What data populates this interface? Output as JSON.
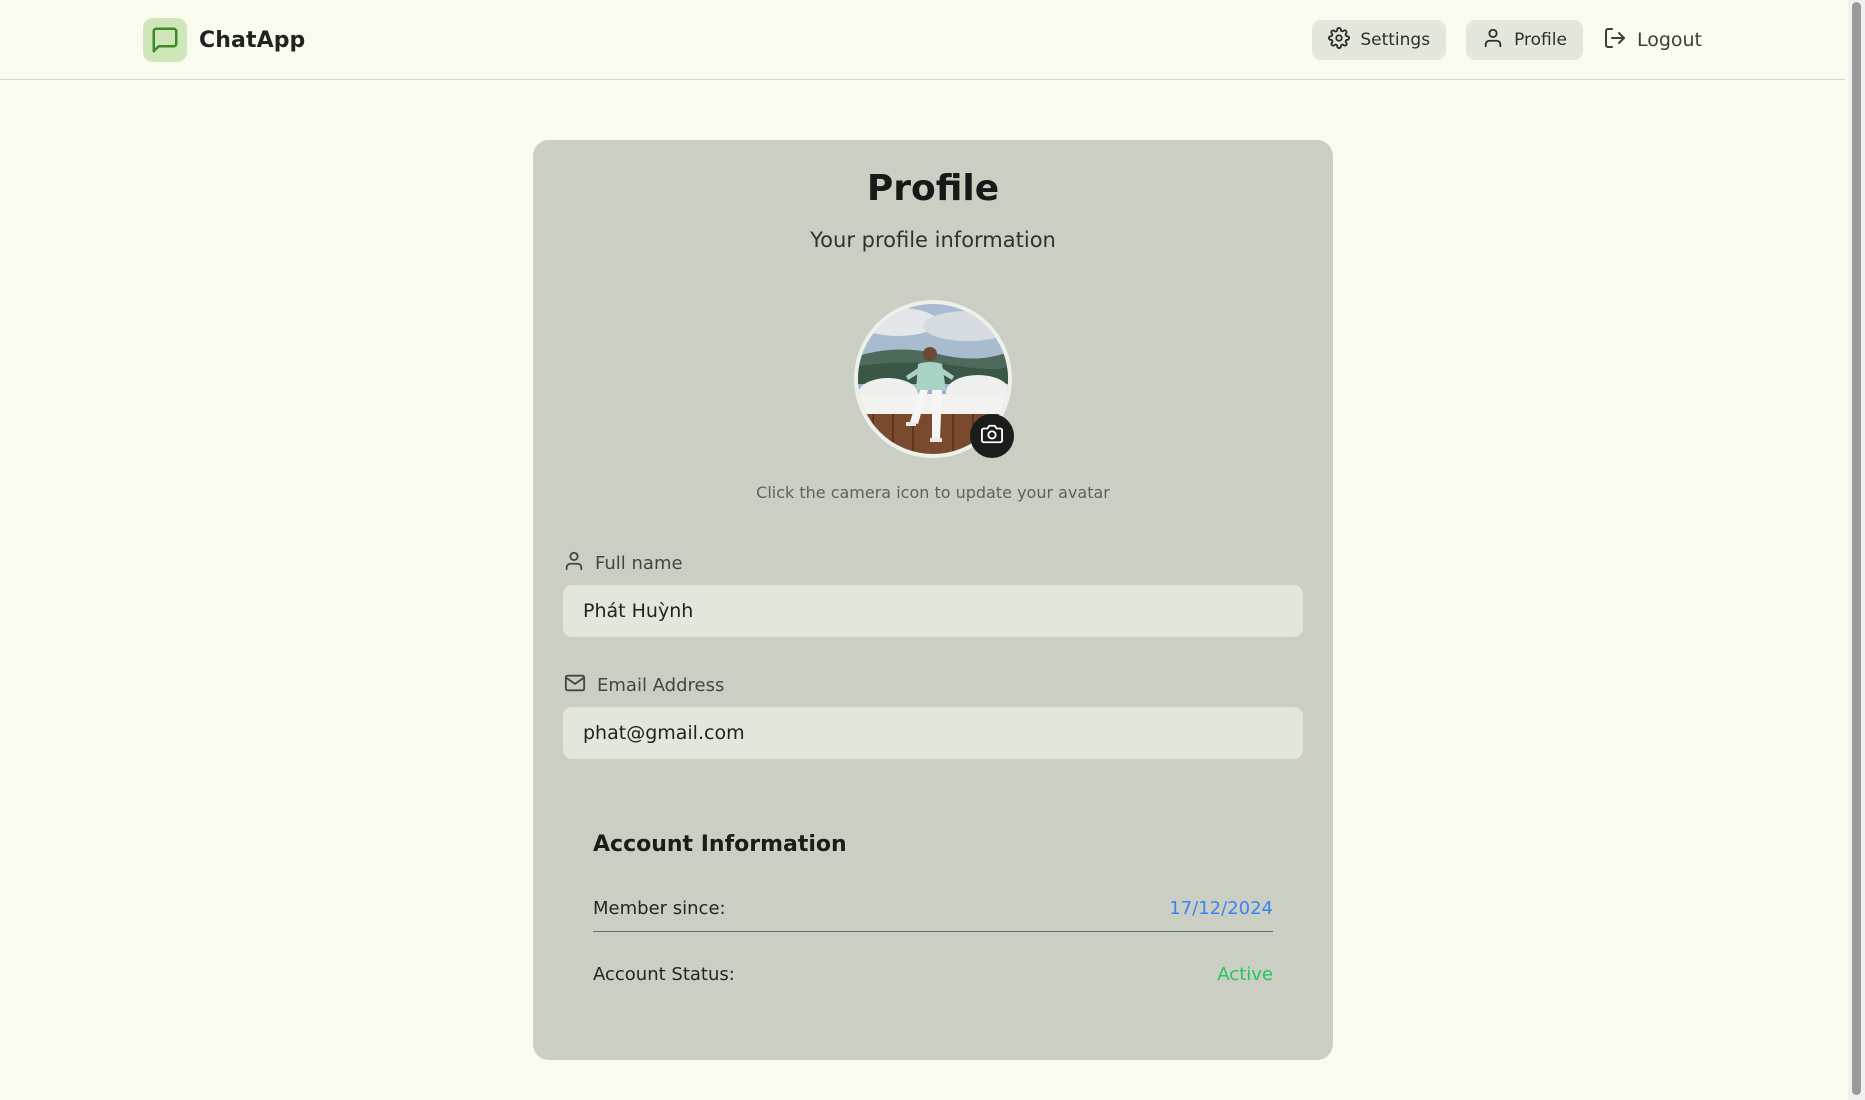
{
  "brand": {
    "name": "ChatApp",
    "accent": "#3c8a24"
  },
  "nav": {
    "settings_label": "Settings",
    "profile_label": "Profile",
    "logout_label": "Logout"
  },
  "profile": {
    "title": "Profile",
    "subtitle": "Your profile information",
    "avatar_hint": "Click the camera icon to update your avatar",
    "full_name_label": "Full name",
    "full_name_value": "Phát Huỳnh",
    "email_label": "Email Address",
    "email_value": "phat@gmail.com"
  },
  "account": {
    "title": "Account Information",
    "member_since_label": "Member since:",
    "member_since_value": "17/12/2024",
    "status_label": "Account Status:",
    "status_value": "Active",
    "date_color": "#3b82f6",
    "status_color": "#22c55e"
  }
}
